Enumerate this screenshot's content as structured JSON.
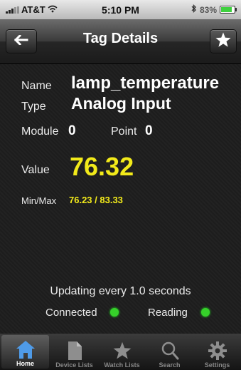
{
  "status_bar": {
    "carrier": "AT&T",
    "time": "5:10 PM",
    "battery": "83%",
    "battery_level": 0.83
  },
  "nav": {
    "title": "Tag Details",
    "back_icon": "arrow-left-icon",
    "favorite_icon": "star-icon"
  },
  "details": {
    "name_label": "Name",
    "name_value": "lamp_temperature",
    "type_label": "Type",
    "type_value": "Analog Input",
    "module_label": "Module",
    "module_value": "0",
    "point_label": "Point",
    "point_value": "0",
    "value_label": "Value",
    "value": "76.32",
    "minmax_label": "Min/Max",
    "minmax_value": "76.23 / 83.33"
  },
  "status": {
    "update_text": "Updating every 1.0 seconds",
    "connected_label": "Connected",
    "reading_label": "Reading",
    "indicator_color": "#36d12a"
  },
  "tabs": [
    {
      "label": "Home",
      "icon": "home-icon",
      "active": true
    },
    {
      "label": "Device Lists",
      "icon": "document-icon",
      "active": false
    },
    {
      "label": "Watch Lists",
      "icon": "star-icon",
      "active": false
    },
    {
      "label": "Search",
      "icon": "search-icon",
      "active": false
    },
    {
      "label": "Settings",
      "icon": "gear-icon",
      "active": false
    }
  ],
  "colors": {
    "accent_yellow": "#f2ea1a",
    "background": "#1d1d1d"
  }
}
